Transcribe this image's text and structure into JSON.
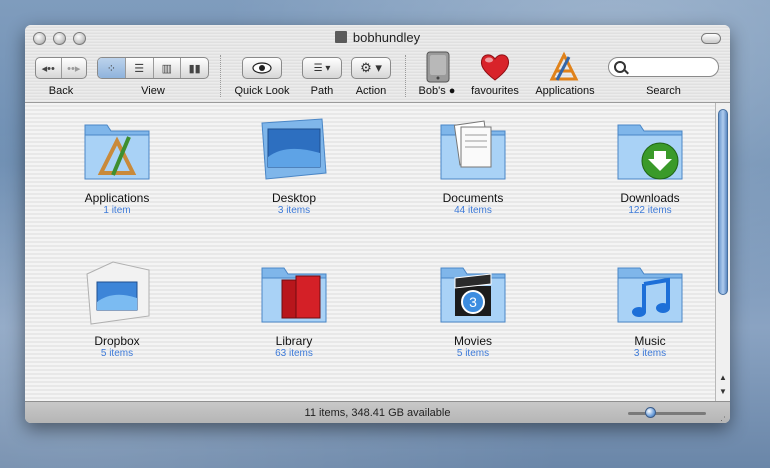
{
  "window": {
    "title": "bobhundley"
  },
  "toolbar": {
    "back_label": "Back",
    "view_label": "View",
    "quicklook_label": "Quick Look",
    "path_label": "Path",
    "action_label": "Action",
    "disk_label": "Bob's",
    "favourites_label": "favourites",
    "applications_label": "Applications",
    "search_label": "Search",
    "search_placeholder": "",
    "view_modes": [
      "icon-view",
      "list-view",
      "column-view",
      "coverflow-view"
    ],
    "view_selected": "icon-view"
  },
  "items": [
    {
      "name": "Applications",
      "count": "1 item",
      "icon": "applications-folder-icon"
    },
    {
      "name": "Desktop",
      "count": "3 items",
      "icon": "desktop-folder-icon"
    },
    {
      "name": "Documents",
      "count": "44 items",
      "icon": "documents-folder-icon"
    },
    {
      "name": "Downloads",
      "count": "122 items",
      "icon": "downloads-folder-icon"
    },
    {
      "name": "Dropbox",
      "count": "5 items",
      "icon": "dropbox-folder-icon"
    },
    {
      "name": "Library",
      "count": "63 items",
      "icon": "library-folder-icon"
    },
    {
      "name": "Movies",
      "count": "5 items",
      "icon": "movies-folder-icon"
    },
    {
      "name": "Music",
      "count": "3 items",
      "icon": "music-folder-icon"
    }
  ],
  "status": {
    "text": "11 items, 348.41 GB available"
  },
  "icon_size_slider": {
    "value": 0.25
  },
  "colors": {
    "accent": "#3d7ad8",
    "folder_blue": "#8cc0ee"
  }
}
